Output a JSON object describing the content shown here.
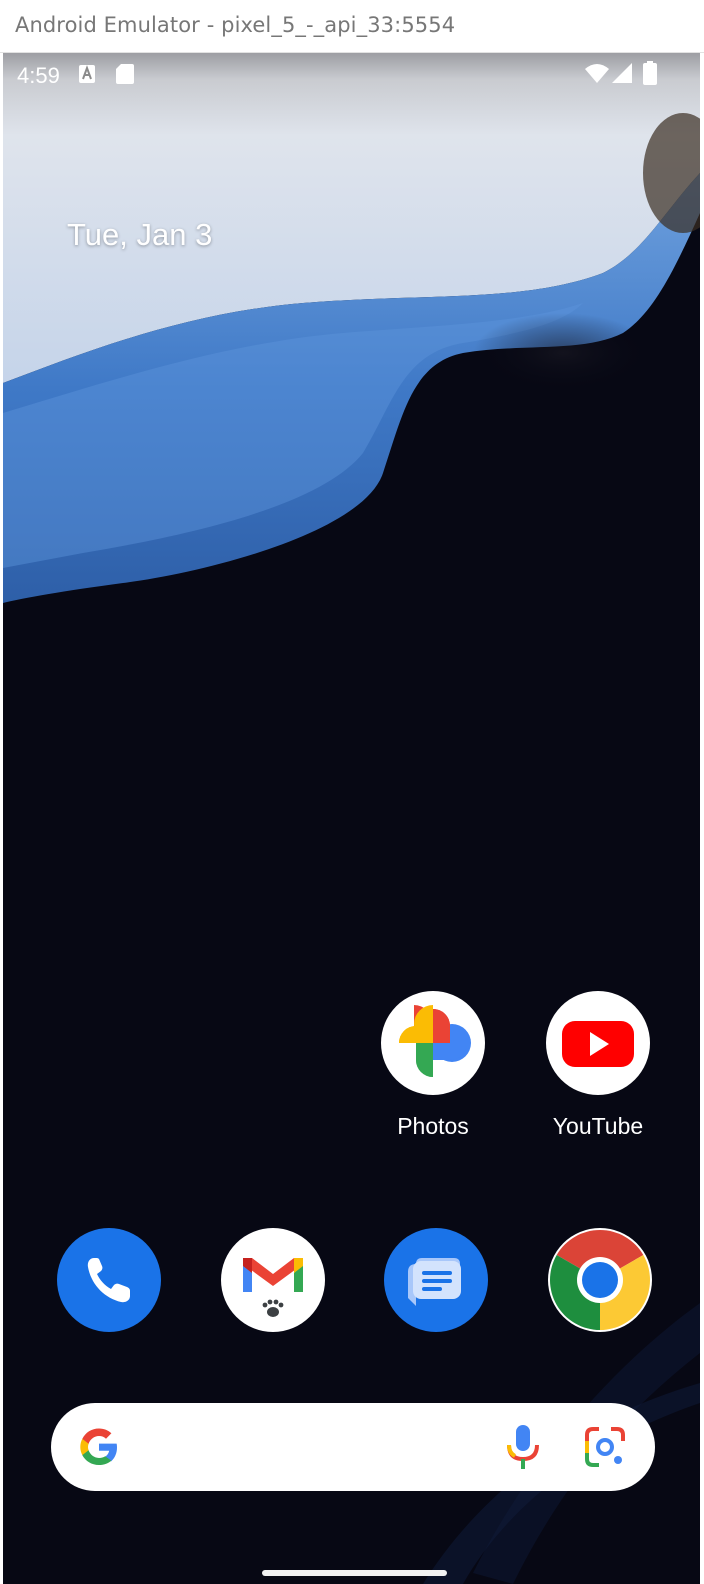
{
  "window": {
    "title": "Android Emulator - pixel_5_-_api_33:5554"
  },
  "statusbar": {
    "time": "4:59",
    "icons": [
      "keyboard-a-icon",
      "sd-card-icon",
      "wifi-icon",
      "signal-icon",
      "battery-icon"
    ]
  },
  "home": {
    "date": "Tue, Jan 3",
    "apps": [
      {
        "label": "Photos",
        "icon": "google-photos-icon"
      },
      {
        "label": "YouTube",
        "icon": "youtube-icon"
      }
    ],
    "dock": [
      {
        "icon": "phone-icon",
        "color": "#1a73e8"
      },
      {
        "icon": "gmail-icon",
        "color": "#ffffff"
      },
      {
        "icon": "messages-icon",
        "color": "#1a73e8"
      },
      {
        "icon": "chrome-icon",
        "color": "#ffffff"
      }
    ],
    "search": {
      "icons": [
        "google-g-icon",
        "microphone-icon",
        "google-lens-icon"
      ]
    }
  }
}
